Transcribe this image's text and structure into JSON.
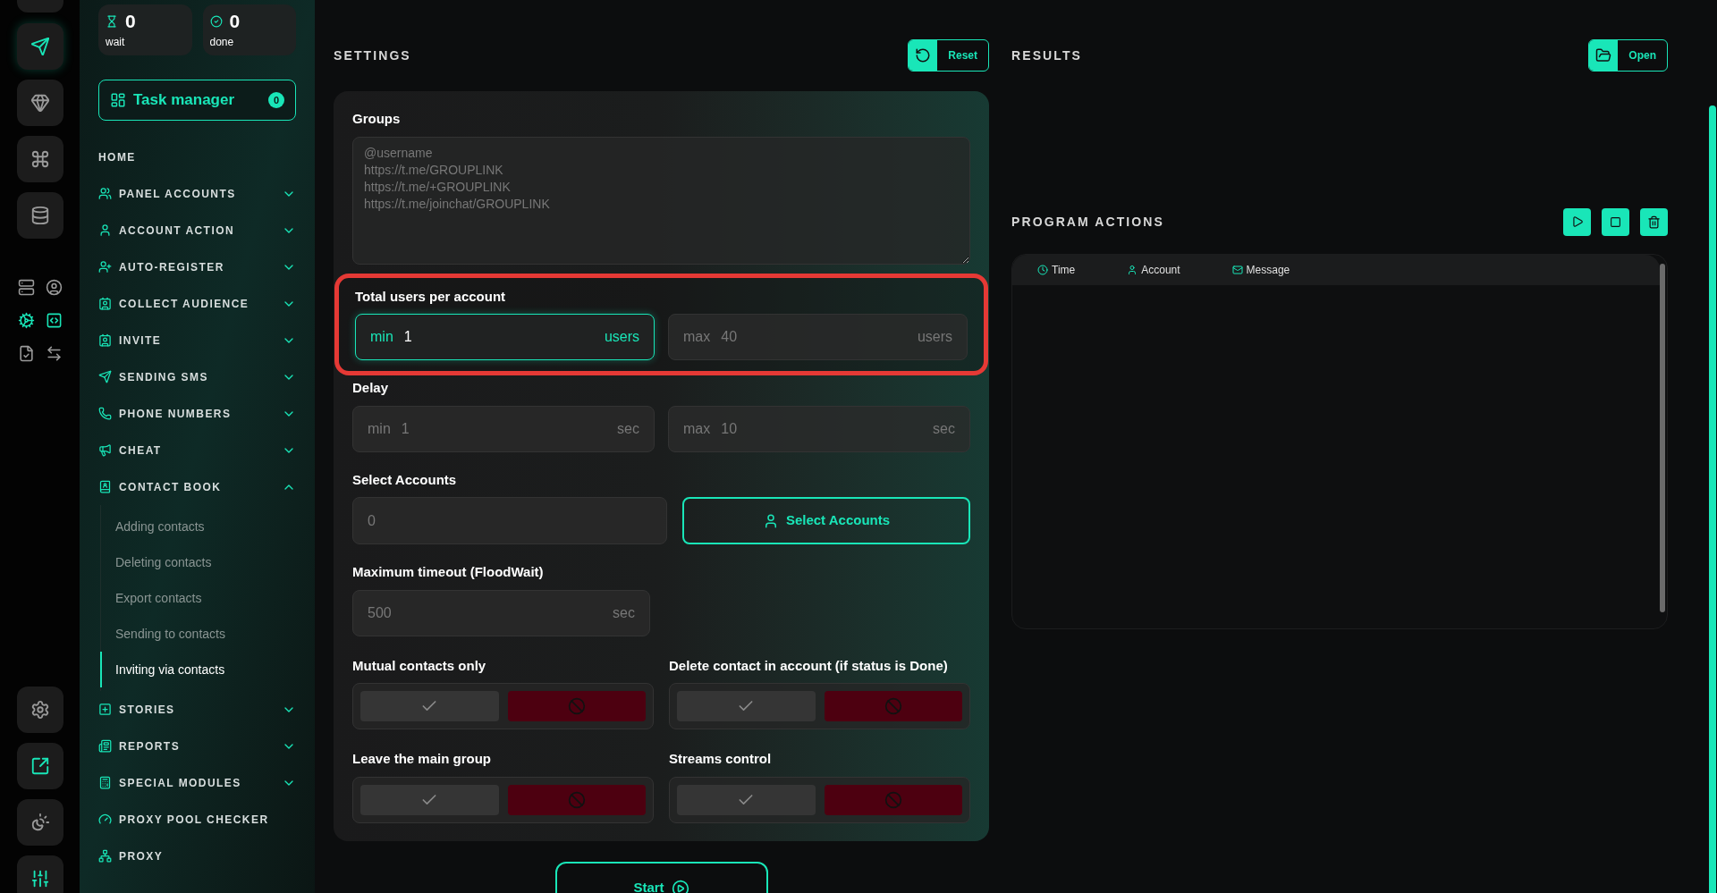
{
  "stats": [
    {
      "value": "0",
      "label": "wait"
    },
    {
      "value": "0",
      "label": "done"
    }
  ],
  "task_manager": {
    "label": "Task manager",
    "count": "0"
  },
  "sidebar": {
    "items": [
      {
        "label": "HOME",
        "kind": "link"
      },
      {
        "label": "PANEL ACCOUNTS",
        "kind": "group",
        "expanded": false
      },
      {
        "label": "ACCOUNT ACTION",
        "kind": "group",
        "expanded": false
      },
      {
        "label": "AUTO-REGISTER",
        "kind": "group",
        "expanded": false
      },
      {
        "label": "COLLECT AUDIENCE",
        "kind": "group",
        "expanded": false
      },
      {
        "label": "INVITE",
        "kind": "group",
        "expanded": false
      },
      {
        "label": "SENDING SMS",
        "kind": "group",
        "expanded": false
      },
      {
        "label": "PHONE NUMBERS",
        "kind": "group",
        "expanded": false
      },
      {
        "label": "CHEAT",
        "kind": "group",
        "expanded": false
      },
      {
        "label": "CONTACT BOOK",
        "kind": "group",
        "expanded": true,
        "children": [
          {
            "label": "Adding contacts",
            "selected": false
          },
          {
            "label": "Deleting contacts",
            "selected": false
          },
          {
            "label": "Export contacts",
            "selected": false
          },
          {
            "label": "Sending to contacts",
            "selected": false
          },
          {
            "label": "Inviting via contacts",
            "selected": true
          }
        ]
      },
      {
        "label": "STORIES",
        "kind": "group",
        "expanded": false
      },
      {
        "label": "REPORTS",
        "kind": "group",
        "expanded": false
      },
      {
        "label": "SPECIAL MODULES",
        "kind": "group",
        "expanded": false
      },
      {
        "label": "PROXY POOL CHECKER",
        "kind": "link"
      },
      {
        "label": "PROXY",
        "kind": "link"
      }
    ]
  },
  "settings": {
    "title": "SETTINGS",
    "reset_button": "Reset",
    "groups": {
      "label": "Groups",
      "placeholder": "@username\nhttps://t.me/GROUPLINK\nhttps://t.me/+GROUPLINK\nhttps://t.me/joinchat/GROUPLINK"
    },
    "total_users": {
      "label": "Total users per account",
      "highlighted": true,
      "fields": [
        {
          "prefix": "min",
          "value": "1",
          "suffix": "users",
          "focused": true
        },
        {
          "prefix": "max",
          "value": "40",
          "suffix": "users",
          "focused": false
        }
      ]
    },
    "delay": {
      "label": "Delay",
      "fields": [
        {
          "prefix": "min",
          "value": "1",
          "suffix": "sec",
          "focused": false
        },
        {
          "prefix": "max",
          "value": "10",
          "suffix": "sec",
          "focused": false
        }
      ]
    },
    "select_accounts": {
      "label": "Select Accounts",
      "value": "0",
      "button": "Select Accounts"
    },
    "max_timeout": {
      "label": "Maximum timeout (FloodWait)",
      "value": "500",
      "suffix": "sec"
    },
    "toggles": [
      {
        "label": "Mutual contacts only",
        "on": false
      },
      {
        "label": "Delete contact in account (if status is Done)",
        "on": false
      },
      {
        "label": "Leave the main group",
        "on": false
      },
      {
        "label": "Streams control",
        "on": false
      }
    ],
    "start_button": "Start"
  },
  "results": {
    "title": "RESULTS",
    "open_button": "Open"
  },
  "program_actions": {
    "title": "PROGRAM ACTIONS",
    "columns": [
      "Time",
      "Account",
      "Message"
    ]
  }
}
